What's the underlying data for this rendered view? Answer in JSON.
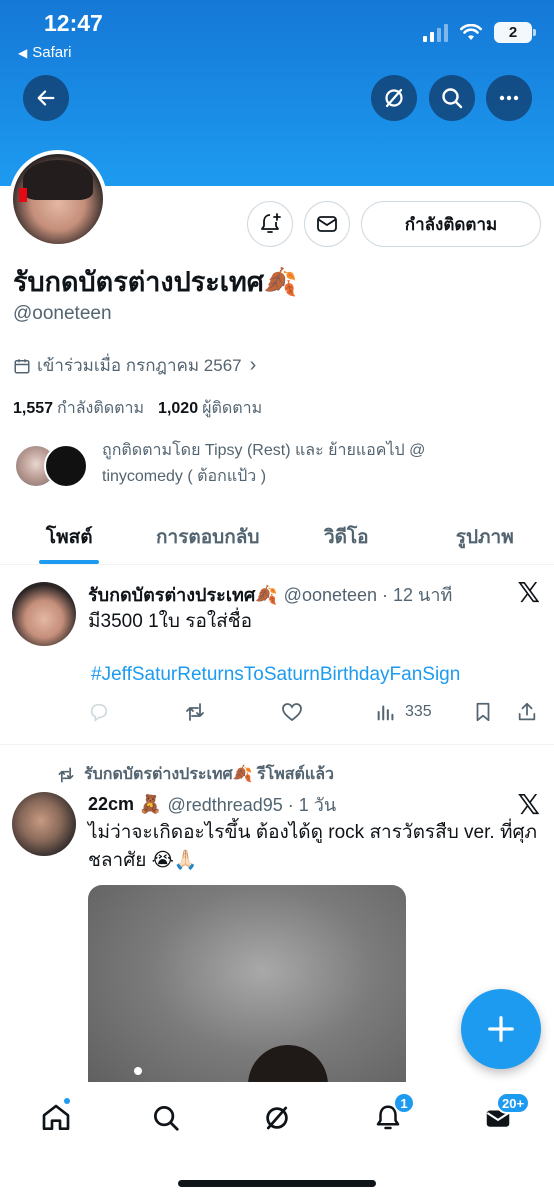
{
  "status_bar": {
    "time": "12:47",
    "back_app": "Safari",
    "battery": "2"
  },
  "profile": {
    "display_name": "รับกดบัตรต่างประเทศ🍂",
    "handle": "@ooneteen",
    "joined": "เข้าร่วมเมื่อ กรกฎาคม 2567",
    "following_count": "1,557",
    "following_label": "กำลังติดตาม",
    "followers_count": "1,020",
    "followers_label": "ผู้ติดตาม",
    "followed_by_text": "ถูกติดตามโดย Tipsy (Rest) และ ย้ายแอคไป @ tinycomedy ( ต้อกแป้ว )",
    "follow_button": "กำลังติดตาม"
  },
  "tabs": [
    {
      "label": "โพสต์",
      "active": true
    },
    {
      "label": "การตอบกลับ",
      "active": false
    },
    {
      "label": "วิดีโอ",
      "active": false
    },
    {
      "label": "รูปภาพ",
      "active": false
    }
  ],
  "posts": [
    {
      "name": "รับกดบัตรต่างประเทศ🍂",
      "handle_time": "@ooneteen · 12 นาที",
      "text": "มี3500 1ใบ รอใส่ชื่อ",
      "hashtag": "#JeffSaturReturnsToSaturnBirthdayFanSign",
      "views": "335"
    },
    {
      "repost_label": "รับกดบัตรต่างประเทศ🍂 รีโพสต์แล้ว",
      "name": "22cm 🧸",
      "handle_time": "@redthread95 · 1 วัน",
      "text": "ไม่ว่าจะเกิดอะไรขึ้น ต้องได้ดู rock สารวัตรสืบ ver. ที่ศุภชลาศัย 😭🙏🏻"
    }
  ],
  "bottom_nav": {
    "notifications_badge": "1",
    "messages_badge": "20+"
  },
  "colors": {
    "accent": "#1d9bf0",
    "text": "#0f1419",
    "muted": "#536471"
  }
}
